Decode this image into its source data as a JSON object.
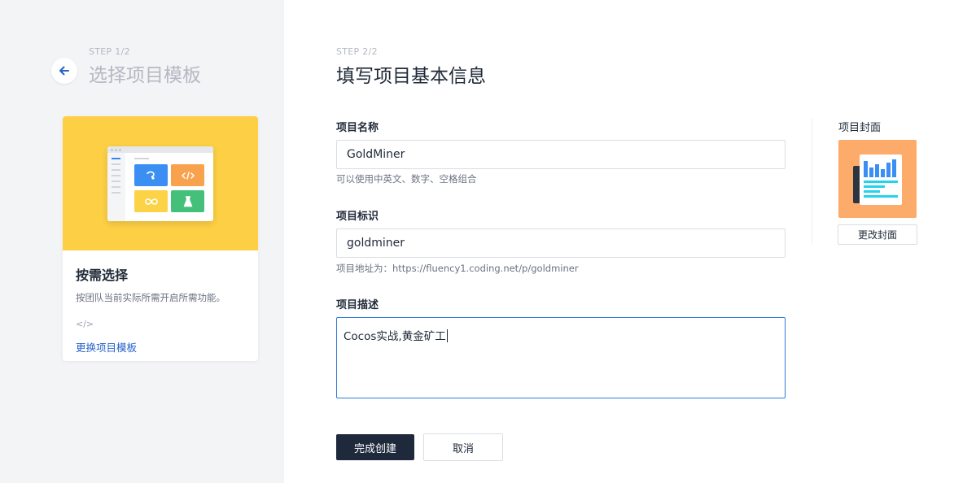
{
  "left": {
    "step": "STEP 1/2",
    "title": "选择项目模板",
    "template_card": {
      "title": "按需选择",
      "description": "按团队当前实际所需开启所需功能。",
      "code_glyph": "</>",
      "change_link": "更换项目模板"
    }
  },
  "main": {
    "step": "STEP 2/2",
    "title": "填写项目基本信息",
    "name": {
      "label": "项目名称",
      "value": "GoldMiner",
      "hint": "可以使用中英文、数字、空格组合"
    },
    "identifier": {
      "label": "项目标识",
      "value": "goldminer",
      "hint": "项目地址为：https://fluency1.coding.net/p/goldminer"
    },
    "description": {
      "label": "项目描述",
      "value": "Cocos实战,黄金矿工"
    },
    "submit_label": "完成创建",
    "cancel_label": "取消"
  },
  "cover": {
    "label": "项目封面",
    "change_label": "更改封面"
  },
  "colors": {
    "card_art_bg": "#fccf44",
    "cover_bg": "#fdab6b",
    "primary_button": "#1e293b",
    "link": "#2563c9",
    "focus_border": "#2f7bd6",
    "left_panel_bg": "#f3f4f6"
  }
}
